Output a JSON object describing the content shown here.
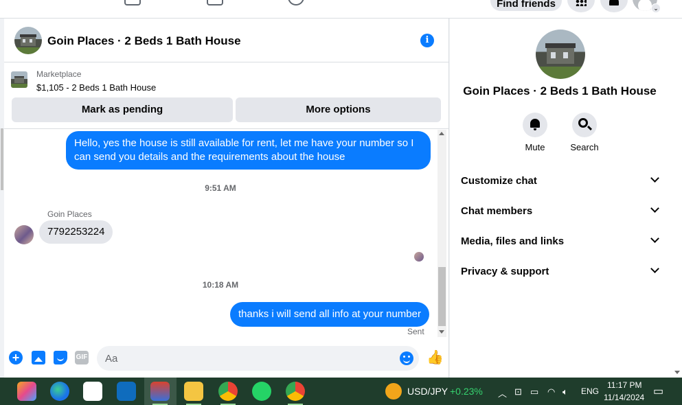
{
  "topnav": {
    "find_friends": "Find friends"
  },
  "chat": {
    "title": "Goin Places · 2 Beds 1 Bath House",
    "info_icon": "i",
    "marketplace": {
      "label": "Marketplace",
      "listing": "$1,105 - 2 Beds 1 Bath House",
      "mark_pending": "Mark as pending",
      "more_options": "More options"
    },
    "messages": [
      {
        "type": "outgoing",
        "text": "Hello, yes the house is still available for rent, let me have your number so I can send you details and the requirements about the house"
      },
      {
        "type": "timestamp",
        "text": "9:51 AM"
      },
      {
        "type": "incoming",
        "sender": "Goin Places",
        "text": "7792253224"
      },
      {
        "type": "timestamp",
        "text": "10:18 AM"
      },
      {
        "type": "outgoing",
        "text": "thanks i will send all info at your number",
        "status": "Sent"
      }
    ],
    "composer": {
      "placeholder": "Aa",
      "gif_label": "GIF"
    }
  },
  "details": {
    "title": "Goin Places · 2 Beds 1 Bath House",
    "actions": [
      {
        "label": "Mute",
        "icon": "bell-icon"
      },
      {
        "label": "Search",
        "icon": "search-icon"
      }
    ],
    "sections": [
      {
        "label": "Customize chat"
      },
      {
        "label": "Chat members"
      },
      {
        "label": "Media, files and links"
      },
      {
        "label": "Privacy & support"
      }
    ]
  },
  "taskbar": {
    "ticker": {
      "name": "USD/JPY",
      "change": "+0.23%"
    },
    "language": "ENG",
    "time": "11:17 PM",
    "date": "11/14/2024"
  },
  "colors": {
    "messenger_blue": "#0a7cff",
    "taskbar_bg": "#1f3d2c",
    "ticker_up": "#36d36f"
  }
}
